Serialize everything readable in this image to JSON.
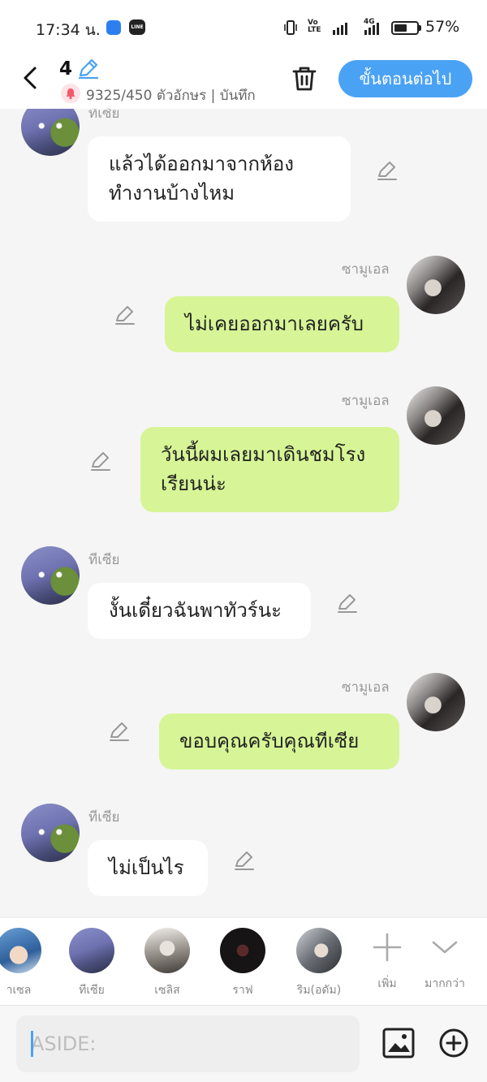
{
  "status_bar": {
    "time": "17:34 น.",
    "line_label": "LINE",
    "volte_label": "Vo\nLTE",
    "network_label": "4G",
    "battery_percent": "57%",
    "battery_level": 0.57
  },
  "header": {
    "episode_number": "4",
    "char_count": "9325/450 ตัวอักษร | บันทึก",
    "next_button": "ขั้นตอนต่อไป"
  },
  "messages": [
    {
      "side": "left",
      "sender": "ทีเซีย",
      "lines": [
        "แล้วได้ออกมาจากห้อง",
        "ทำงานบ้างไหม"
      ]
    },
    {
      "side": "right",
      "sender": "ซามูเอล",
      "lines": [
        "ไม่เคยออกมาเลยครับ"
      ]
    },
    {
      "side": "right",
      "sender": "ซามูเอล",
      "lines": [
        "วันนี้ผมเลยมาเดินชมโรง",
        "เรียนน่ะ"
      ]
    },
    {
      "side": "left",
      "sender": "ทีเซีย",
      "lines": [
        "งั้นเดี๋ยวฉันพาทัวร์นะ"
      ]
    },
    {
      "side": "right",
      "sender": "ซามูเอล",
      "lines": [
        "ขอบคุณครับคุณทีเซีย"
      ]
    },
    {
      "side": "left",
      "sender": "ทีเซีย",
      "lines": [
        "ไม่เป็นไร"
      ]
    }
  ],
  "character_bar": {
    "characters": [
      "าเซล",
      "ทีเซีย",
      "เซลิส",
      "ราฟ",
      "ริม(อดัม)"
    ],
    "add_label": "เพิ่ม",
    "more_label": "มากกว่า"
  },
  "input": {
    "placeholder": "ASIDE:"
  },
  "colors": {
    "accent": "#4aa2f5",
    "right_bubble": "#d7f596",
    "left_bubble": "#ffffff",
    "background": "#f5f5f5"
  }
}
